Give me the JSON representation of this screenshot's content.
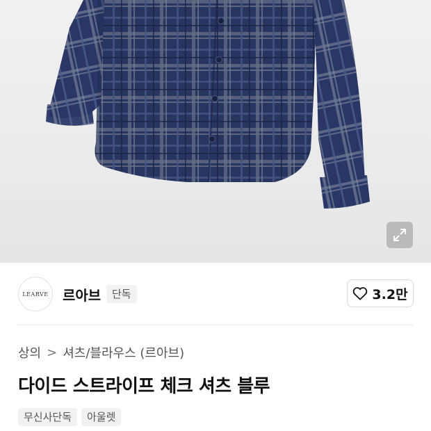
{
  "product_image": {
    "alt": "navy plaid shirt",
    "icons": {
      "expand": "expand-arrows-icon"
    },
    "colors": {
      "fabric": "#2c3a6a",
      "background": "#ececec"
    }
  },
  "brand": {
    "logo_text": "LEARVE",
    "name": "르아브",
    "badge": "단독"
  },
  "like": {
    "icon": "heart-outline-icon",
    "count": "3.2만"
  },
  "breadcrumb": {
    "items": [
      "상의",
      "셔츠/블라우스 (르아브)"
    ],
    "separator": ">"
  },
  "product": {
    "title": "다이드 스트라이프 체크 셔츠 블루"
  },
  "tags": [
    "무신사단독",
    "아울렛"
  ]
}
